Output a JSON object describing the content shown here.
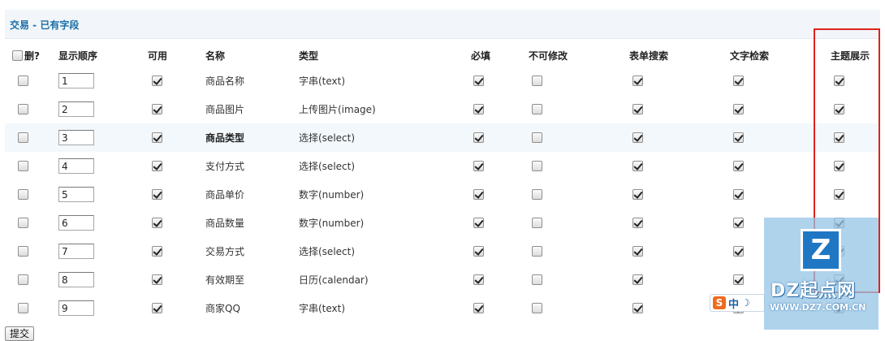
{
  "section": {
    "title": "交易 - 已有字段"
  },
  "headers": {
    "delete": "删?",
    "order": "显示顺序",
    "enabled": "可用",
    "name": "名称",
    "type": "类型",
    "required": "必填",
    "unchangeable": "不可修改",
    "form_search": "表单搜索",
    "text_search": "文字检索",
    "topic_display": "主题展示"
  },
  "rows": [
    {
      "order": "1",
      "name": "商品名称",
      "type": "字串(text)",
      "delete": false,
      "enabled": true,
      "required": true,
      "unchangeable": false,
      "form_search": true,
      "text_search": true,
      "topic_display": true
    },
    {
      "order": "2",
      "name": "商品图片",
      "type": "上传图片(image)",
      "delete": false,
      "enabled": true,
      "required": true,
      "unchangeable": false,
      "form_search": true,
      "text_search": true,
      "topic_display": true
    },
    {
      "order": "3",
      "name": "商品类型",
      "type": "选择(select)",
      "delete": false,
      "enabled": true,
      "required": true,
      "unchangeable": false,
      "form_search": true,
      "text_search": true,
      "topic_display": true
    },
    {
      "order": "4",
      "name": "支付方式",
      "type": "选择(select)",
      "delete": false,
      "enabled": true,
      "required": true,
      "unchangeable": false,
      "form_search": true,
      "text_search": true,
      "topic_display": true
    },
    {
      "order": "5",
      "name": "商品单价",
      "type": "数字(number)",
      "delete": false,
      "enabled": true,
      "required": true,
      "unchangeable": false,
      "form_search": true,
      "text_search": true,
      "topic_display": true
    },
    {
      "order": "6",
      "name": "商品数量",
      "type": "数字(number)",
      "delete": false,
      "enabled": true,
      "required": true,
      "unchangeable": false,
      "form_search": true,
      "text_search": true,
      "topic_display": true
    },
    {
      "order": "7",
      "name": "交易方式",
      "type": "选择(select)",
      "delete": false,
      "enabled": true,
      "required": true,
      "unchangeable": false,
      "form_search": true,
      "text_search": true,
      "topic_display": true
    },
    {
      "order": "8",
      "name": "有效期至",
      "type": "日历(calendar)",
      "delete": false,
      "enabled": true,
      "required": true,
      "unchangeable": false,
      "form_search": true,
      "text_search": true,
      "topic_display": true
    },
    {
      "order": "9",
      "name": "商家QQ",
      "type": "字串(text)",
      "delete": false,
      "enabled": true,
      "required": true,
      "unchangeable": false,
      "form_search": true,
      "text_search": true,
      "topic_display": true
    }
  ],
  "highlighted_row_index": 2,
  "submit_label": "提交",
  "watermark": {
    "logo": "Z",
    "name": "DZ起点网",
    "url": "WWW.DZ7.COM.CN"
  },
  "ime": {
    "logo": "S",
    "lang": "中",
    "mode": "☽"
  },
  "colors": {
    "title": "#1b6ea6",
    "highlight_border": "#e0211d",
    "row_alt": "#f3f8fc"
  }
}
